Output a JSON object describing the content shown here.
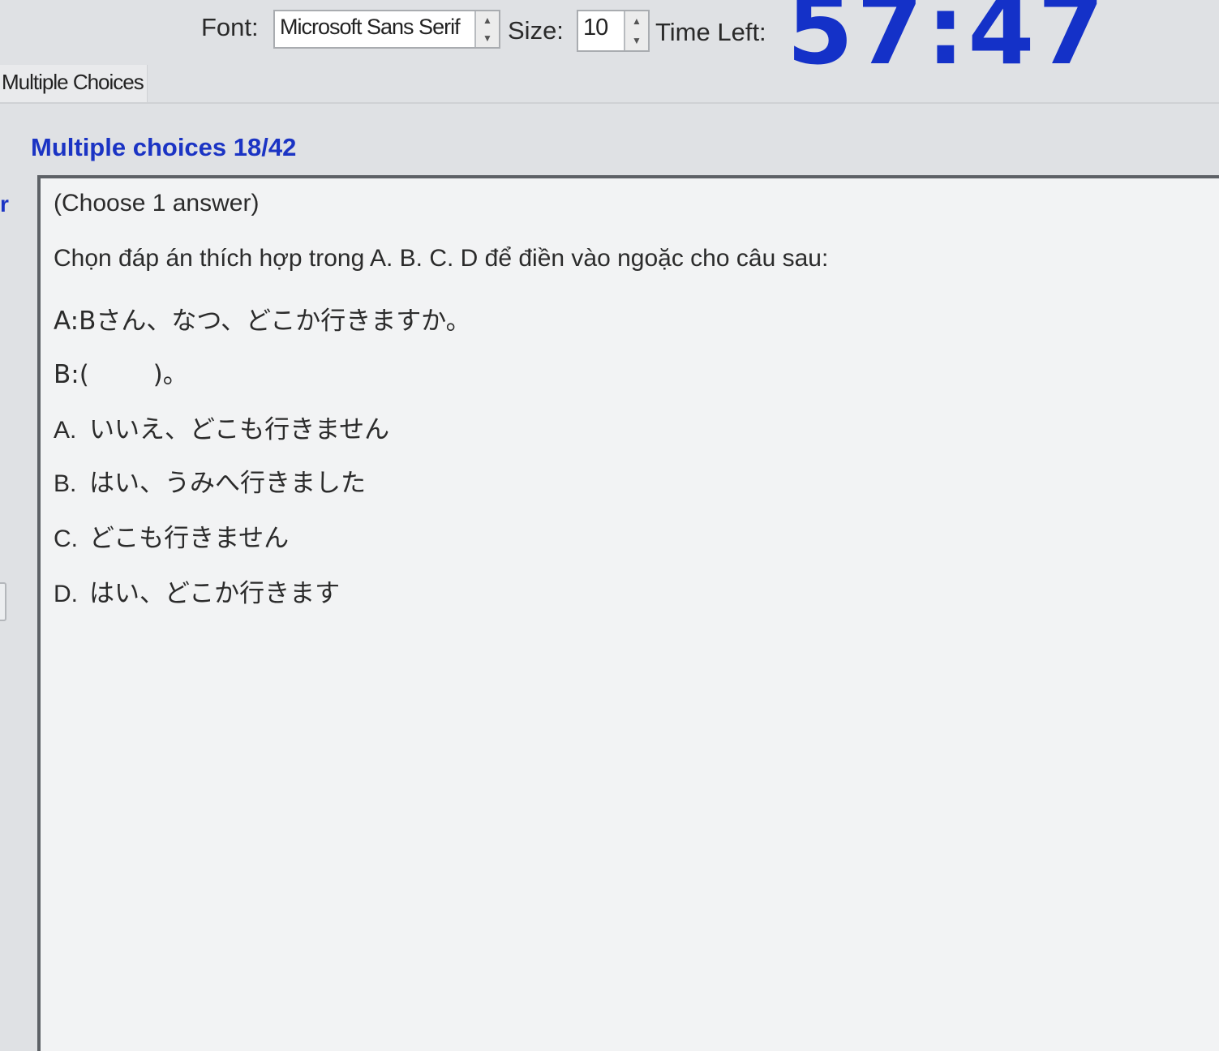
{
  "toolbar": {
    "font_label": "Font:",
    "font_value": "Microsoft Sans Serif",
    "size_label": "Size:",
    "size_value": "10",
    "time_left_label": "Time Left:",
    "timer": "57:47",
    "timer_color": "#1431c8"
  },
  "tab": {
    "label": "Multiple Choices"
  },
  "section": {
    "title": "Multiple choices 18/42",
    "title_color": "#1b34c4",
    "left_mark": "r"
  },
  "question": {
    "instruction": "(Choose 1 answer)",
    "prompt": "Chọn đáp án thích hợp trong A. B. C. D để điền vào ngoặc cho câu sau:",
    "line_a": "A:Bさん、なつ、どこか行きますか。",
    "line_b": "B:(        )。",
    "options": [
      {
        "letter": "A.",
        "text": "いいえ、どこも行きません"
      },
      {
        "letter": "B.",
        "text": "はい、うみへ行きました"
      },
      {
        "letter": "C.",
        "text": "どこも行きません"
      },
      {
        "letter": "D.",
        "text": "はい、どこか行きます"
      }
    ]
  }
}
